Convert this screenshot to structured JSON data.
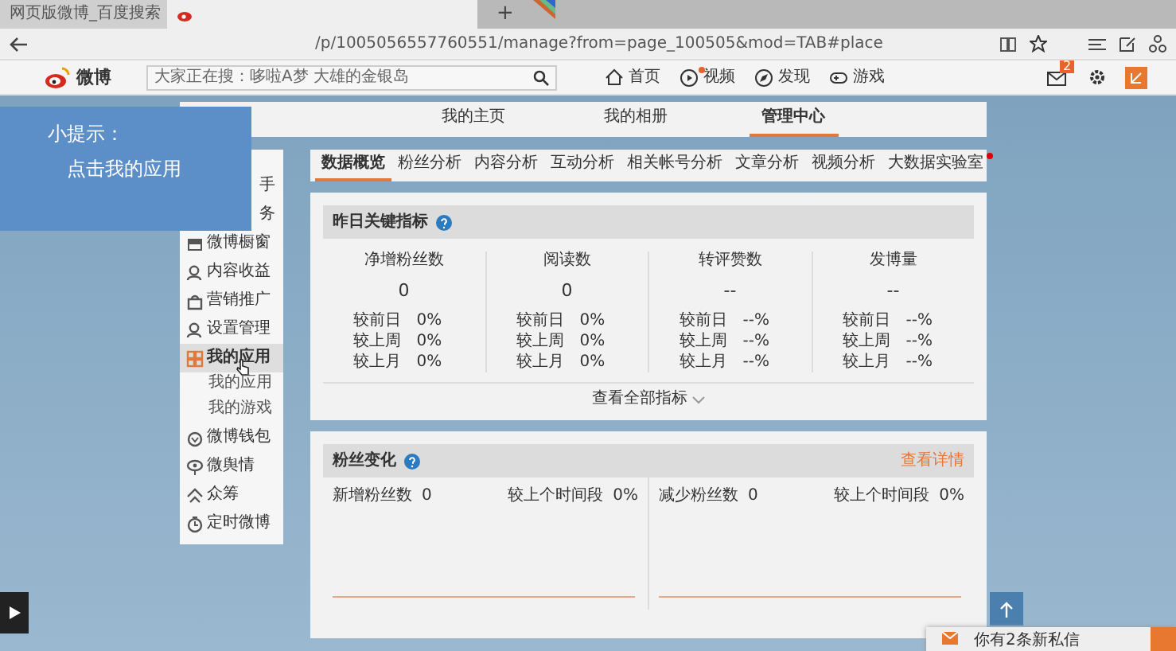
{
  "browser": {
    "tabs": [
      {
        "title": "网页版微博_百度搜索",
        "selected": false
      },
      {
        "selected": true
      }
    ],
    "new_tab": "+",
    "address": "/p/1005056557760551/manage?from=page_100505&mod=TAB#place"
  },
  "site_nav": {
    "logo": "微博",
    "search_placeholder": "大家正在搜：哆啦A梦 大雄的金银岛",
    "links": [
      {
        "label": "首页",
        "kind": "home",
        "dot": false
      },
      {
        "label": "视频",
        "kind": "video",
        "dot": true
      },
      {
        "label": "发现",
        "kind": "compass",
        "dot": false
      },
      {
        "label": "游戏",
        "kind": "game",
        "dot": false
      }
    ],
    "mail_badge": "2"
  },
  "tip": {
    "title": "小提示：",
    "text": "点击我的应用"
  },
  "page_tabs": [
    {
      "label": "我的主页",
      "selected": false
    },
    {
      "label": "我的相册",
      "selected": false
    },
    {
      "label": "管理中心",
      "selected": true
    }
  ],
  "sidebar": {
    "items": [
      {
        "label": "手",
        "kind": "clipped",
        "selected": false
      },
      {
        "label": "务",
        "kind": "clipped",
        "selected": false
      },
      {
        "label": "微博橱窗",
        "kind": "shop",
        "selected": false
      },
      {
        "label": "内容收益",
        "kind": "user",
        "selected": false
      },
      {
        "label": "营销推广",
        "kind": "bag",
        "selected": false
      },
      {
        "label": "设置管理",
        "kind": "user",
        "selected": false
      },
      {
        "label": "我的应用",
        "kind": "apps",
        "selected": true,
        "children": [
          {
            "label": "我的应用"
          },
          {
            "label": "我的游戏"
          }
        ]
      },
      {
        "label": "微博钱包",
        "kind": "wallet",
        "selected": false
      },
      {
        "label": "微舆情",
        "kind": "eye",
        "selected": false
      },
      {
        "label": "众筹",
        "kind": "crowd",
        "selected": false
      },
      {
        "label": "定时微博",
        "kind": "timer",
        "selected": false
      }
    ]
  },
  "analysis_tabs": [
    {
      "label": "数据概览",
      "selected": true,
      "dot": false
    },
    {
      "label": "粉丝分析",
      "selected": false,
      "dot": false
    },
    {
      "label": "内容分析",
      "selected": false,
      "dot": false
    },
    {
      "label": "互动分析",
      "selected": false,
      "dot": false
    },
    {
      "label": "相关帐号分析",
      "selected": false,
      "dot": false
    },
    {
      "label": "文章分析",
      "selected": false,
      "dot": false
    },
    {
      "label": "视频分析",
      "selected": false,
      "dot": false
    },
    {
      "label": "大数据实验室",
      "selected": false,
      "dot": true
    }
  ],
  "key_metrics": {
    "title": "昨日关键指标",
    "columns": [
      {
        "name": "净增粉丝数",
        "value": "0",
        "comparisons": [
          {
            "label": "较前日",
            "value": "0%"
          },
          {
            "label": "较上周",
            "value": "0%"
          },
          {
            "label": "较上月",
            "value": "0%"
          }
        ]
      },
      {
        "name": "阅读数",
        "value": "0",
        "comparisons": [
          {
            "label": "较前日",
            "value": "0%"
          },
          {
            "label": "较上周",
            "value": "0%"
          },
          {
            "label": "较上月",
            "value": "0%"
          }
        ]
      },
      {
        "name": "转评赞数",
        "value": "--",
        "comparisons": [
          {
            "label": "较前日",
            "value": "--%"
          },
          {
            "label": "较上周",
            "value": "--%"
          },
          {
            "label": "较上月",
            "value": "--%"
          }
        ]
      },
      {
        "name": "发博量",
        "value": "--",
        "comparisons": [
          {
            "label": "较前日",
            "value": "--%"
          },
          {
            "label": "较上周",
            "value": "--%"
          },
          {
            "label": "较上月",
            "value": "--%"
          }
        ]
      }
    ],
    "more": "查看全部指标"
  },
  "fan_change": {
    "title": "粉丝变化",
    "link": "查看详情",
    "halves": [
      {
        "label": "新增粉丝数",
        "value": "0",
        "compare_label": "较上个时间段",
        "compare_value": "0%"
      },
      {
        "label": "减少粉丝数",
        "value": "0",
        "compare_label": "较上个时间段",
        "compare_value": "0%"
      }
    ]
  },
  "message_popup": {
    "text": "你有2条新私信"
  }
}
